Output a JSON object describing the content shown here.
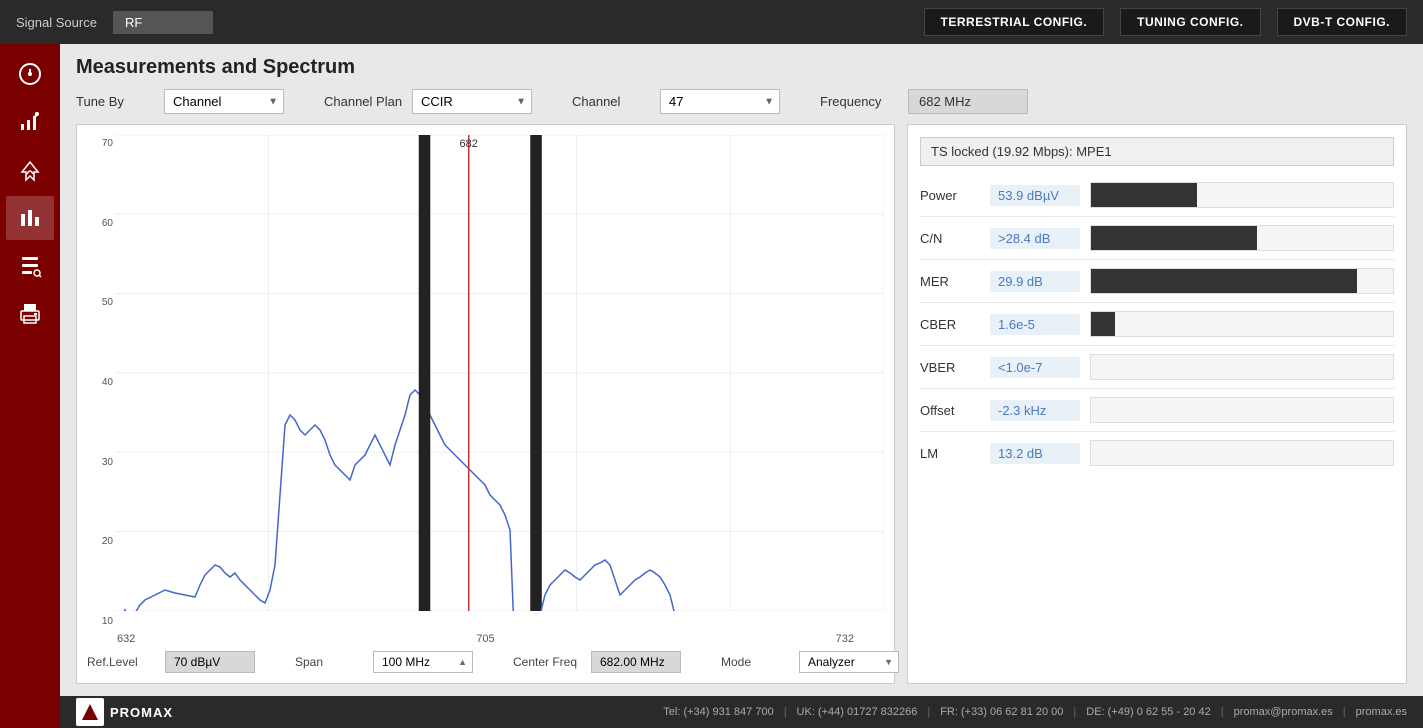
{
  "topbar": {
    "signal_source_label": "Signal Source",
    "signal_source_value": "RF",
    "btn_terrestrial": "TERRESTRIAL CONFIG.",
    "btn_tuning": "TUNING CONFIG.",
    "btn_dvbt": "DVB-T CONFIG."
  },
  "sidebar": {
    "items": [
      {
        "id": "dashboard",
        "icon": "gauge"
      },
      {
        "id": "spectrum",
        "icon": "chart-settings"
      },
      {
        "id": "signal",
        "icon": "signal"
      },
      {
        "id": "measurements",
        "icon": "bar-chart"
      },
      {
        "id": "tools",
        "icon": "tools"
      },
      {
        "id": "print",
        "icon": "print"
      }
    ]
  },
  "page": {
    "title": "Measurements and Spectrum",
    "tune_by_label": "Tune By",
    "tune_by_value": "Channel",
    "channel_plan_label": "Channel Plan",
    "channel_plan_value": "CCIR",
    "channel_label": "Channel",
    "channel_value": "47",
    "frequency_label": "Frequency",
    "frequency_value": "682 MHz",
    "ts_status": "TS locked (19.92 Mbps): MPE1"
  },
  "measurements": [
    {
      "label": "Power",
      "value": "53.9 dBµV",
      "bar_pct": 35
    },
    {
      "label": "C/N",
      "value": ">28.4 dB",
      "bar_pct": 55
    },
    {
      "label": "MER",
      "value": "29.9 dB",
      "bar_pct": 88
    },
    {
      "label": "CBER",
      "value": "1.6e-5",
      "bar_pct": 8
    },
    {
      "label": "VBER",
      "value": "<1.0e-7",
      "bar_pct": 0
    },
    {
      "label": "Offset",
      "value": "-2.3 kHz",
      "bar_pct": 0
    },
    {
      "label": "LM",
      "value": "13.2 dB",
      "bar_pct": 0
    }
  ],
  "spectrum": {
    "ref_level_label": "Ref.Level",
    "ref_level_value": "70 dBµV",
    "span_label": "Span",
    "span_value": "100 MHz",
    "center_freq_label": "Center Freq",
    "center_freq_value": "682.00 MHz",
    "mode_label": "Mode",
    "mode_value": "Analyzer",
    "x_labels": [
      "632",
      "705",
      "732"
    ],
    "x_center": "682",
    "y_labels": [
      "70",
      "60",
      "50",
      "40",
      "30",
      "20",
      "10"
    ]
  },
  "footer": {
    "logo_text": "PROMAX",
    "tel": "Tel: (+34) 931 847 700",
    "uk": "UK: (+44) 01727 832266",
    "fr": "FR: (+33) 06 62 81 20 00",
    "de": "DE: (+49) 0 62 55 - 20 42",
    "email": "promax@promax.es",
    "website": "promax.es"
  }
}
